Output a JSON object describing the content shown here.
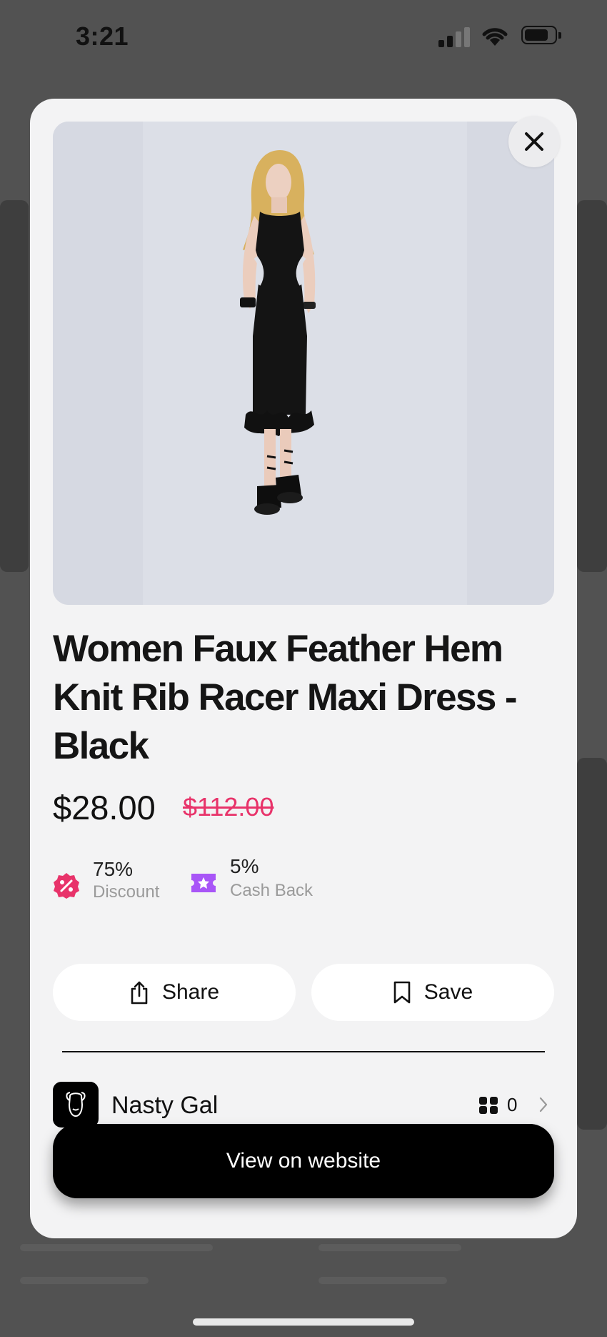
{
  "status_bar": {
    "time": "3:21"
  },
  "product": {
    "title": "Women Faux Feather Hem Knit Rib Racer Maxi Dress - Black",
    "price_current": "$28.00",
    "price_original": "$112.00"
  },
  "stats": [
    {
      "value": "75%",
      "label": "Discount",
      "icon": "discount-badge-icon",
      "color": "#e8336a"
    },
    {
      "value": "5%",
      "label": "Cash Back",
      "icon": "cashback-ticket-icon",
      "color": "#a855f7"
    }
  ],
  "actions": {
    "share_label": "Share",
    "save_label": "Save"
  },
  "brand": {
    "name": "Nasty Gal",
    "count": "0"
  },
  "cta": {
    "label": "View on website"
  },
  "colors": {
    "accent_pink": "#e8336a",
    "accent_purple": "#a855f7",
    "modal_bg": "#f3f3f4"
  }
}
